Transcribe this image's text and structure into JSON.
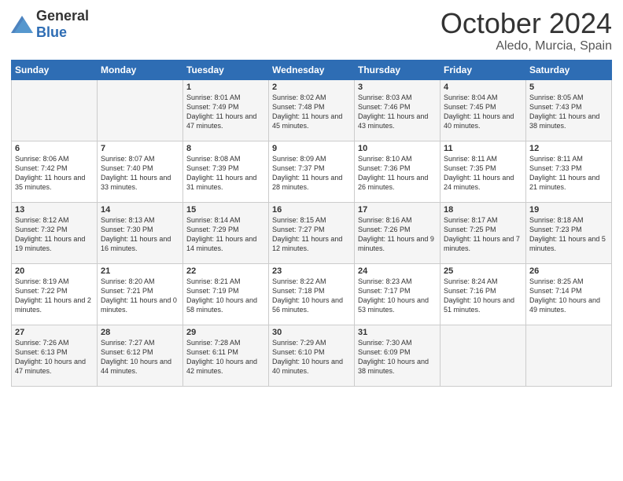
{
  "logo": {
    "general": "General",
    "blue": "Blue"
  },
  "header": {
    "month": "October 2024",
    "location": "Aledo, Murcia, Spain"
  },
  "days_of_week": [
    "Sunday",
    "Monday",
    "Tuesday",
    "Wednesday",
    "Thursday",
    "Friday",
    "Saturday"
  ],
  "weeks": [
    [
      {
        "day": "",
        "info": ""
      },
      {
        "day": "",
        "info": ""
      },
      {
        "day": "1",
        "info": "Sunrise: 8:01 AM\nSunset: 7:49 PM\nDaylight: 11 hours and 47 minutes."
      },
      {
        "day": "2",
        "info": "Sunrise: 8:02 AM\nSunset: 7:48 PM\nDaylight: 11 hours and 45 minutes."
      },
      {
        "day": "3",
        "info": "Sunrise: 8:03 AM\nSunset: 7:46 PM\nDaylight: 11 hours and 43 minutes."
      },
      {
        "day": "4",
        "info": "Sunrise: 8:04 AM\nSunset: 7:45 PM\nDaylight: 11 hours and 40 minutes."
      },
      {
        "day": "5",
        "info": "Sunrise: 8:05 AM\nSunset: 7:43 PM\nDaylight: 11 hours and 38 minutes."
      }
    ],
    [
      {
        "day": "6",
        "info": "Sunrise: 8:06 AM\nSunset: 7:42 PM\nDaylight: 11 hours and 35 minutes."
      },
      {
        "day": "7",
        "info": "Sunrise: 8:07 AM\nSunset: 7:40 PM\nDaylight: 11 hours and 33 minutes."
      },
      {
        "day": "8",
        "info": "Sunrise: 8:08 AM\nSunset: 7:39 PM\nDaylight: 11 hours and 31 minutes."
      },
      {
        "day": "9",
        "info": "Sunrise: 8:09 AM\nSunset: 7:37 PM\nDaylight: 11 hours and 28 minutes."
      },
      {
        "day": "10",
        "info": "Sunrise: 8:10 AM\nSunset: 7:36 PM\nDaylight: 11 hours and 26 minutes."
      },
      {
        "day": "11",
        "info": "Sunrise: 8:11 AM\nSunset: 7:35 PM\nDaylight: 11 hours and 24 minutes."
      },
      {
        "day": "12",
        "info": "Sunrise: 8:11 AM\nSunset: 7:33 PM\nDaylight: 11 hours and 21 minutes."
      }
    ],
    [
      {
        "day": "13",
        "info": "Sunrise: 8:12 AM\nSunset: 7:32 PM\nDaylight: 11 hours and 19 minutes."
      },
      {
        "day": "14",
        "info": "Sunrise: 8:13 AM\nSunset: 7:30 PM\nDaylight: 11 hours and 16 minutes."
      },
      {
        "day": "15",
        "info": "Sunrise: 8:14 AM\nSunset: 7:29 PM\nDaylight: 11 hours and 14 minutes."
      },
      {
        "day": "16",
        "info": "Sunrise: 8:15 AM\nSunset: 7:27 PM\nDaylight: 11 hours and 12 minutes."
      },
      {
        "day": "17",
        "info": "Sunrise: 8:16 AM\nSunset: 7:26 PM\nDaylight: 11 hours and 9 minutes."
      },
      {
        "day": "18",
        "info": "Sunrise: 8:17 AM\nSunset: 7:25 PM\nDaylight: 11 hours and 7 minutes."
      },
      {
        "day": "19",
        "info": "Sunrise: 8:18 AM\nSunset: 7:23 PM\nDaylight: 11 hours and 5 minutes."
      }
    ],
    [
      {
        "day": "20",
        "info": "Sunrise: 8:19 AM\nSunset: 7:22 PM\nDaylight: 11 hours and 2 minutes."
      },
      {
        "day": "21",
        "info": "Sunrise: 8:20 AM\nSunset: 7:21 PM\nDaylight: 11 hours and 0 minutes."
      },
      {
        "day": "22",
        "info": "Sunrise: 8:21 AM\nSunset: 7:19 PM\nDaylight: 10 hours and 58 minutes."
      },
      {
        "day": "23",
        "info": "Sunrise: 8:22 AM\nSunset: 7:18 PM\nDaylight: 10 hours and 56 minutes."
      },
      {
        "day": "24",
        "info": "Sunrise: 8:23 AM\nSunset: 7:17 PM\nDaylight: 10 hours and 53 minutes."
      },
      {
        "day": "25",
        "info": "Sunrise: 8:24 AM\nSunset: 7:16 PM\nDaylight: 10 hours and 51 minutes."
      },
      {
        "day": "26",
        "info": "Sunrise: 8:25 AM\nSunset: 7:14 PM\nDaylight: 10 hours and 49 minutes."
      }
    ],
    [
      {
        "day": "27",
        "info": "Sunrise: 7:26 AM\nSunset: 6:13 PM\nDaylight: 10 hours and 47 minutes."
      },
      {
        "day": "28",
        "info": "Sunrise: 7:27 AM\nSunset: 6:12 PM\nDaylight: 10 hours and 44 minutes."
      },
      {
        "day": "29",
        "info": "Sunrise: 7:28 AM\nSunset: 6:11 PM\nDaylight: 10 hours and 42 minutes."
      },
      {
        "day": "30",
        "info": "Sunrise: 7:29 AM\nSunset: 6:10 PM\nDaylight: 10 hours and 40 minutes."
      },
      {
        "day": "31",
        "info": "Sunrise: 7:30 AM\nSunset: 6:09 PM\nDaylight: 10 hours and 38 minutes."
      },
      {
        "day": "",
        "info": ""
      },
      {
        "day": "",
        "info": ""
      }
    ]
  ]
}
